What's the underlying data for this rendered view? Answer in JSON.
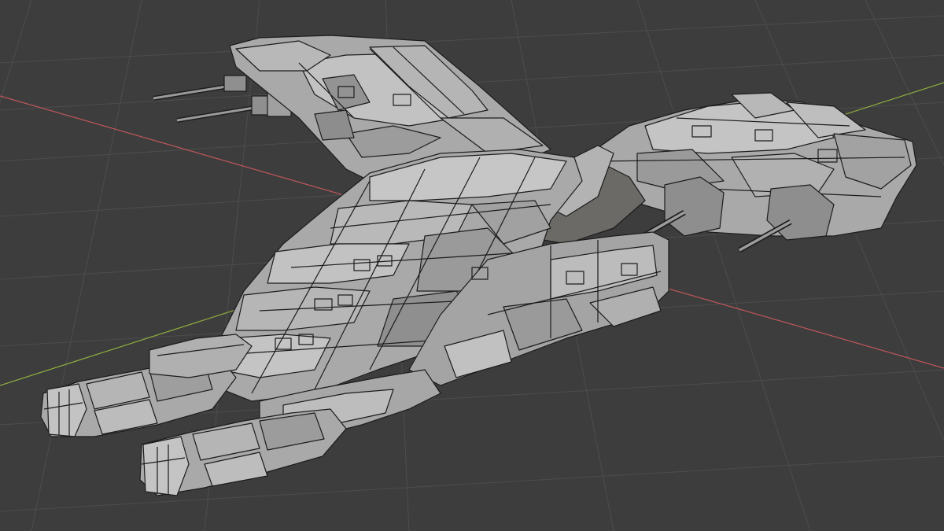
{
  "viewport": {
    "type": "3d-viewport",
    "shading": "solid-wireframe",
    "grid": true,
    "object_name": "spaceship-model"
  },
  "colors": {
    "background": "#3d3d3d",
    "grid_line": "#4d4d4d",
    "x_axis": "#c0575c",
    "y_axis": "#8cab3e",
    "hull": "#a9a9a9",
    "hull_light": "#c4c4c4",
    "hull_dark": "#838383",
    "edge": "#1c1c1c"
  }
}
